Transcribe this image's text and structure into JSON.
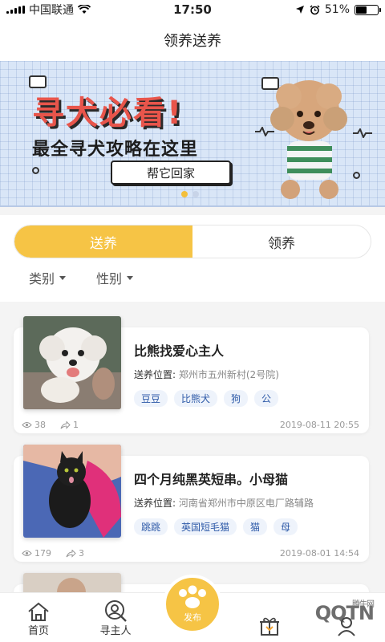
{
  "status": {
    "carrier": "中国联通",
    "time": "17:50",
    "battery": "51%",
    "battery_level": 0.51
  },
  "nav": {
    "title": "领养送养"
  },
  "banner": {
    "title": "寻犬必看!",
    "subtitle": "最全寻犬攻略在这里",
    "button_label": "帮它回家",
    "active_dot": 0,
    "dot_count": 2
  },
  "tabs": [
    {
      "label": "送养",
      "active": true
    },
    {
      "label": "领养",
      "active": false
    }
  ],
  "filters": [
    {
      "label": "类别"
    },
    {
      "label": "性别"
    }
  ],
  "listings": [
    {
      "title": "比熊找爱心主人",
      "location_label": "送养位置:",
      "location": "郑州市五州新村(2号院)",
      "tags": [
        "豆豆",
        "比熊犬",
        "狗",
        "公"
      ],
      "views": "38",
      "shares": "1",
      "date": "2019-08-11 20:55"
    },
    {
      "title": "四个月纯黑英短串。小母猫",
      "location_label": "送养位置:",
      "location": "河南省郑州市中原区电厂路辅路",
      "tags": [
        "跳跳",
        "英国短毛猫",
        "猫",
        "母"
      ],
      "views": "179",
      "shares": "3",
      "date": "2019-08-01 14:54"
    }
  ],
  "tabbar": {
    "items": [
      {
        "label": "首页",
        "icon": "home-icon"
      },
      {
        "label": "寻主人",
        "icon": "search-owner-icon"
      },
      {
        "label": "",
        "icon": "gift-icon"
      },
      {
        "label": "",
        "icon": "profile-icon"
      }
    ],
    "publish_label": "发布"
  },
  "watermark": {
    "text": "腾牛网",
    "logo": "QQTN"
  },
  "colors": {
    "accent": "#f6c445",
    "tag_bg": "#eef3fb",
    "tag_text": "#2e5aa8"
  }
}
